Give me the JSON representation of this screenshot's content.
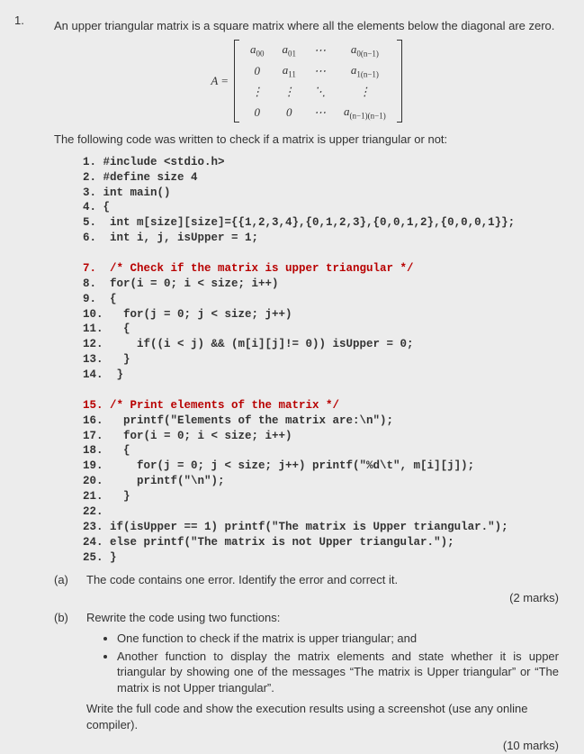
{
  "question_number": "1.",
  "intro": "An upper triangular matrix is a square matrix where all the elements below the diagonal are zero.",
  "matrix": {
    "lhs": "A =",
    "rows": [
      [
        "a",
        "a",
        "⋯",
        "a"
      ],
      [
        "0",
        "a",
        "⋯",
        "a"
      ],
      [
        "⋮",
        "⋮",
        "⋱",
        "⋮"
      ],
      [
        "0",
        "0",
        "⋯",
        "a"
      ]
    ],
    "subs": [
      [
        "00",
        "01",
        "",
        "0(n−1)"
      ],
      [
        "",
        "11",
        "",
        "1(n−1)"
      ],
      [
        "",
        "",
        "",
        ""
      ],
      [
        "",
        "",
        "",
        "(n−1)(n−1)"
      ]
    ]
  },
  "lead": "The following code was written to check if a matrix is upper triangular or not:",
  "code": {
    "l1": "1. #include <stdio.h>",
    "l2": "2. #define size 4",
    "l3": "3. int main()",
    "l4": "4. {",
    "l5": "5.  int m[size][size]={{1,2,3,4},{0,1,2,3},{0,0,1,2},{0,0,0,1}};",
    "l6": "6.  int i, j, isUpper = 1;",
    "l7": "7.  /* Check if the matrix is upper triangular */",
    "l8": "8.  for(i = 0; i < size; i++)",
    "l9": "9.  {",
    "l10": "10.   for(j = 0; j < size; j++)",
    "l11": "11.   {",
    "l12": "12.     if((i < j) && (m[i][j]!= 0)) isUpper = 0;",
    "l13": "13.   }",
    "l14": "14.  }",
    "l15": "15. /* Print elements of the matrix */",
    "l16": "16.   printf(\"Elements of the matrix are:\\n\");",
    "l17": "17.   for(i = 0; i < size; i++)",
    "l18": "18.   {",
    "l19": "19.     for(j = 0; j < size; j++) printf(\"%d\\t\", m[i][j]);",
    "l20": "20.     printf(\"\\n\");",
    "l21": "21.   }",
    "l22": "22.",
    "l23": "23. if(isUpper == 1) printf(\"The matrix is Upper triangular.\");",
    "l24": "24. else printf(\"The matrix is not Upper triangular.\");",
    "l25": "25. }"
  },
  "parts": {
    "a": {
      "label": "(a)",
      "text": "The code contains one error. Identify the error and correct it.",
      "marks": "(2 marks)"
    },
    "b": {
      "label": "(b)",
      "text": "Rewrite the code using two functions:",
      "bullets": [
        "One function to check if the matrix is upper triangular; and",
        "Another function to display the matrix elements and state whether it is upper triangular by showing one of the messages “The matrix is Upper triangular” or “The matrix is not Upper triangular”."
      ],
      "tail": "Write the full code and show the execution results using a screenshot (use any online compiler).",
      "marks": "(10 marks)"
    }
  }
}
